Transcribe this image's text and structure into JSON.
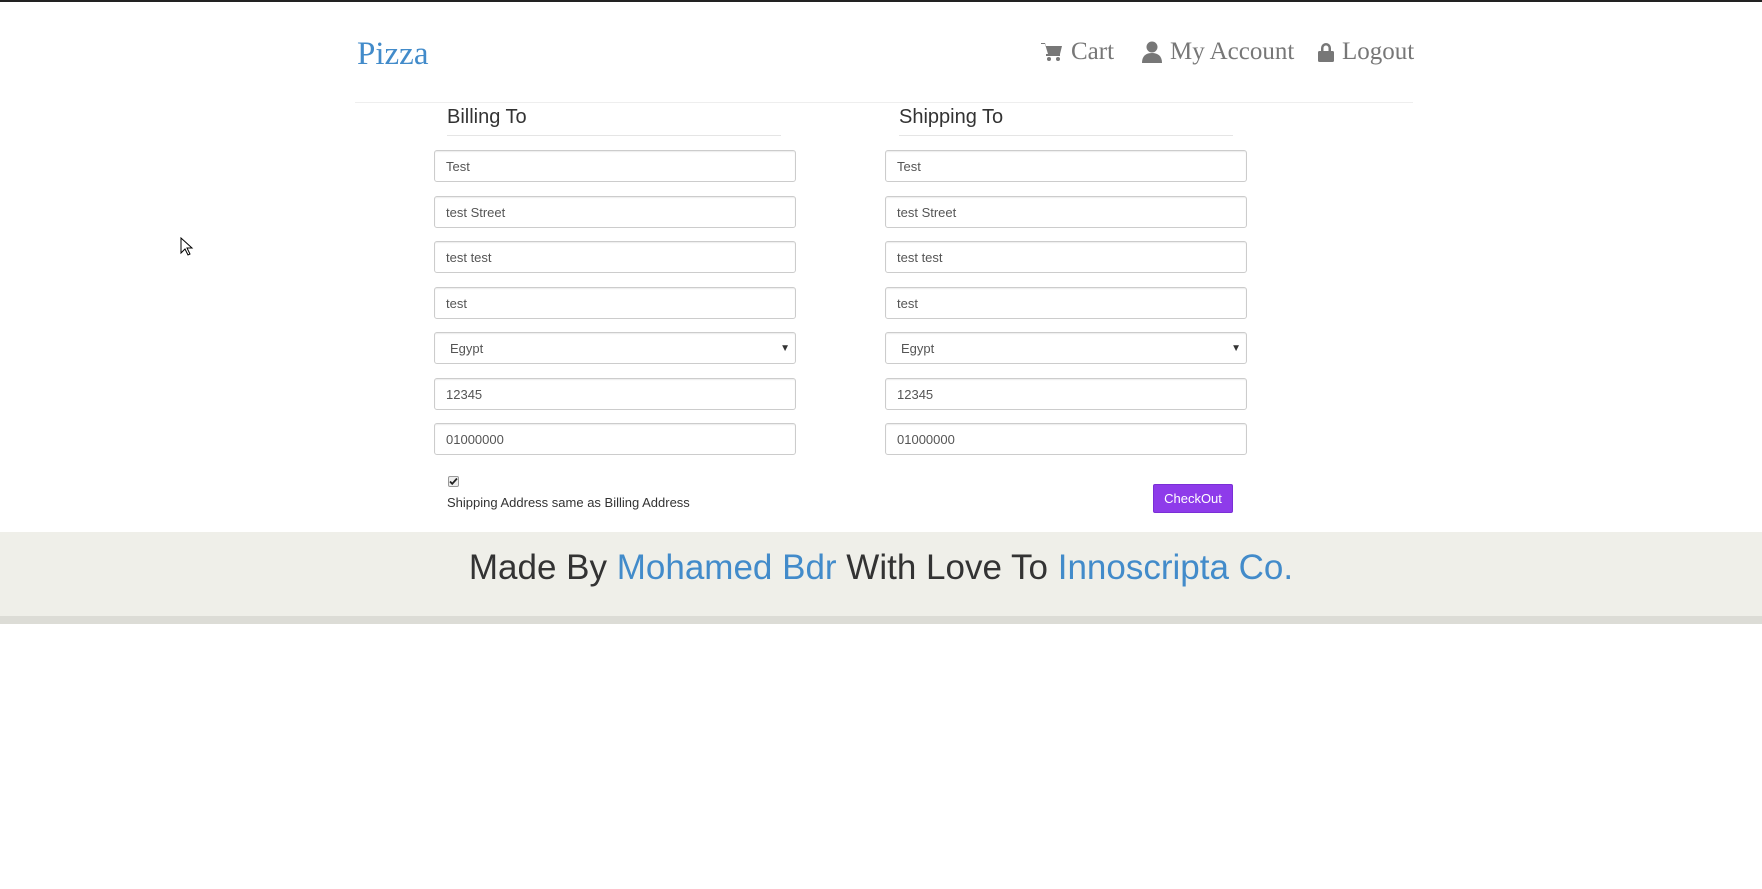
{
  "brand": "Pizza",
  "nav": {
    "cart": {
      "label": "Cart",
      "icon": "cart-icon"
    },
    "account": {
      "label": "My Account",
      "icon": "user-icon"
    },
    "logout": {
      "label": "Logout",
      "icon": "lock-icon"
    }
  },
  "billing": {
    "heading": "Billing To",
    "name": "Test",
    "street": "test Street",
    "address2": "test test",
    "city": "test",
    "country": "Egypt",
    "zip": "12345",
    "phone": "01000000"
  },
  "shipping": {
    "heading": "Shipping To",
    "name": "Test",
    "street": "test Street",
    "address2": "test test",
    "city": "test",
    "country": "Egypt",
    "zip": "12345",
    "phone": "01000000"
  },
  "same_address": {
    "label": "Shipping Address same as Billing Address",
    "checked": true
  },
  "checkout_label": "CheckOut",
  "footer": {
    "made_by": "Made By",
    "author": "Mohamed Bdr",
    "with_love": "With Love To",
    "company": "Innoscripta Co."
  },
  "colors": {
    "link": "#428bca",
    "checkout_button": "#8e3bea",
    "footer_bg": "#efefe9"
  }
}
